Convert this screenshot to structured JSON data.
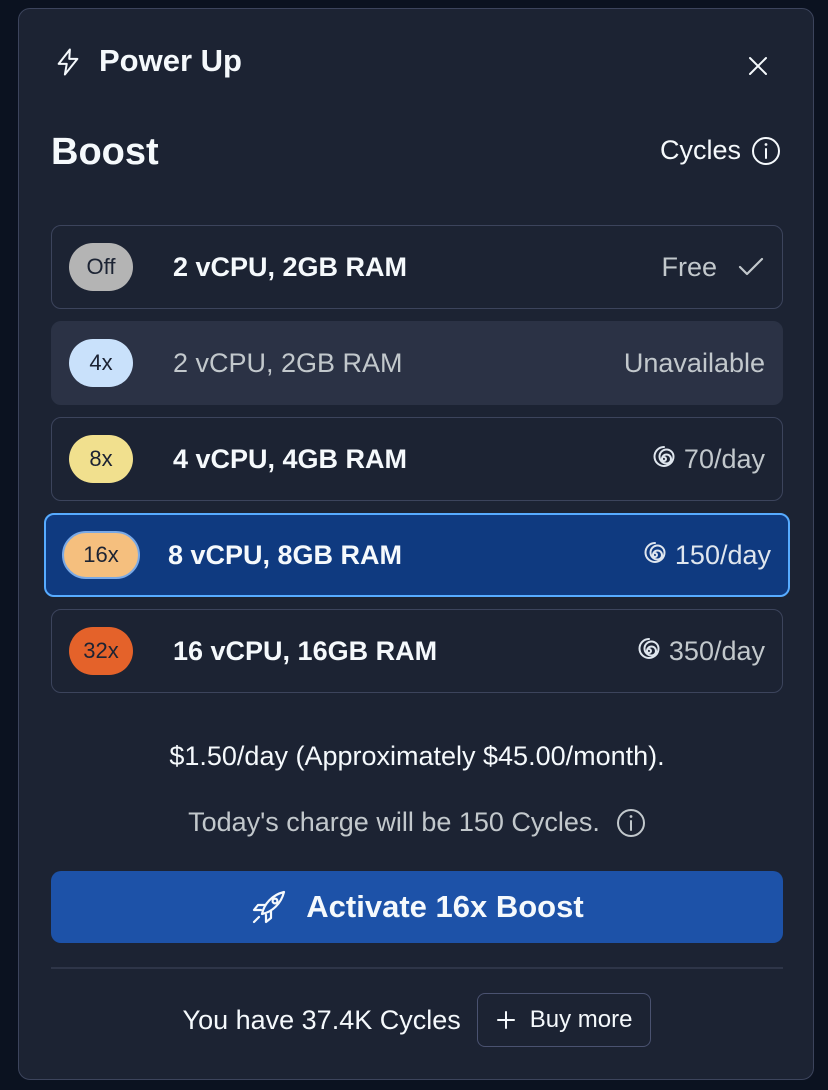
{
  "header": {
    "title": "Power Up",
    "icon": "lightning-icon",
    "close_icon": "close-icon"
  },
  "boost": {
    "title": "Boost",
    "cycles_label": "Cycles",
    "options": [
      {
        "badge": "Off",
        "badge_color": "#b4b4b4",
        "spec": "2 vCPU, 2GB RAM",
        "price": "Free",
        "state": "current"
      },
      {
        "badge": "4x",
        "badge_color": "#c9e1fb",
        "spec": "2 vCPU, 2GB RAM",
        "price": "Unavailable",
        "state": "disabled"
      },
      {
        "badge": "8x",
        "badge_color": "#f1e08e",
        "spec": "4 vCPU, 4GB RAM",
        "price": "70/day",
        "state": "available"
      },
      {
        "badge": "16x",
        "badge_color": "#f5bf7e",
        "spec": "8 vCPU, 8GB RAM",
        "price": "150/day",
        "state": "selected"
      },
      {
        "badge": "32x",
        "badge_color": "#e4622a",
        "spec": "16 vCPU, 16GB RAM",
        "price": "350/day",
        "state": "available"
      }
    ]
  },
  "summary": {
    "cost": "$1.50/day (Approximately $45.00/month).",
    "charge": "Today's charge will be 150 Cycles."
  },
  "actions": {
    "activate_label": "Activate 16x Boost",
    "balance": "You have 37.4K Cycles",
    "buy_more_label": "Buy more"
  },
  "colors": {
    "panel_bg": "#1c2333",
    "accent": "#1d52a8",
    "selected_border": "#57abff"
  }
}
